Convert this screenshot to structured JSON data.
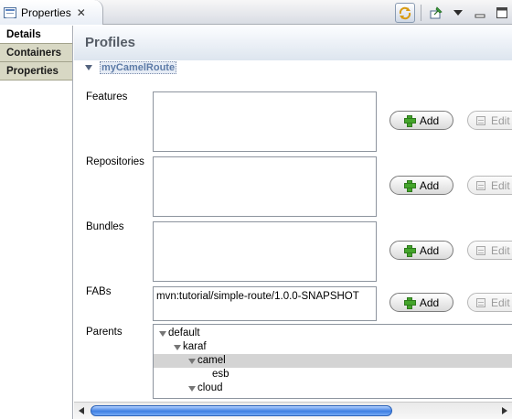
{
  "view_tab": {
    "label": "Properties",
    "close_glyph": "✕"
  },
  "view_toolbar": {
    "icons": [
      "sync-icon",
      "pin-icon",
      "view-menu-icon",
      "minimize-icon",
      "maximize-icon"
    ]
  },
  "left_tabs": [
    {
      "label": "Details",
      "active": true
    },
    {
      "label": "Containers",
      "active": false
    },
    {
      "label": "Properties",
      "active": false
    }
  ],
  "page": {
    "title": "Profiles",
    "section_name": "myCamelRoute"
  },
  "fields": {
    "features": {
      "label": "Features"
    },
    "repositories": {
      "label": "Repositories"
    },
    "bundles": {
      "label": "Bundles"
    },
    "fabs": {
      "label": "FABs",
      "value": "mvn:tutorial/simple-route/1.0.0-SNAPSHOT"
    },
    "parents": {
      "label": "Parents"
    }
  },
  "buttons": {
    "add_label": "Add",
    "edit_label": "Edit"
  },
  "parents_tree": [
    {
      "label": "default",
      "depth": 0,
      "expanded": true,
      "selected": false
    },
    {
      "label": "karaf",
      "depth": 1,
      "expanded": true,
      "selected": false
    },
    {
      "label": "camel",
      "depth": 2,
      "expanded": true,
      "selected": true
    },
    {
      "label": "esb",
      "depth": 3,
      "expanded": false,
      "selected": false
    },
    {
      "label": "cloud",
      "depth": 2,
      "expanded": true,
      "selected": false
    }
  ],
  "colors": {
    "accent": "#5d7ba7",
    "add_icon": "#44a52b",
    "scroll_thumb": "#3d7fe3",
    "tab_inactive": "#d8d8c4"
  }
}
